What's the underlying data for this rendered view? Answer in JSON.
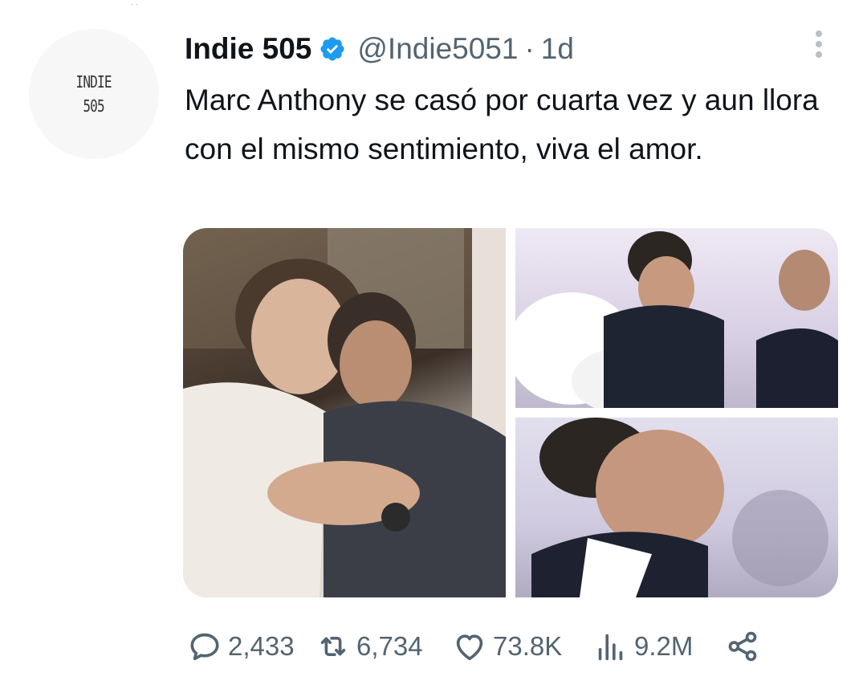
{
  "avatar": {
    "line1": "INDIE",
    "line2": "505"
  },
  "tweet": {
    "display_name": "Indie 505",
    "handle": "@Indie5051",
    "separator": "·",
    "time": "1d",
    "text": "Marc Anthony se casó por cuarta vez y aun llora con el mismo sentimiento, viva el amor."
  },
  "icons": {
    "verified": "verified-badge-icon",
    "more": "more-options-icon",
    "reply": "reply-icon",
    "retweet": "retweet-icon",
    "like": "heart-icon",
    "views": "views-icon",
    "share": "share-icon"
  },
  "colors": {
    "verified": "#1d9bf0",
    "text": "#0f1419",
    "muted": "#536471"
  },
  "metrics": {
    "replies": "2,433",
    "retweets": "6,734",
    "likes": "73.8K",
    "views": "9.2M"
  },
  "media": {
    "count": 3
  }
}
